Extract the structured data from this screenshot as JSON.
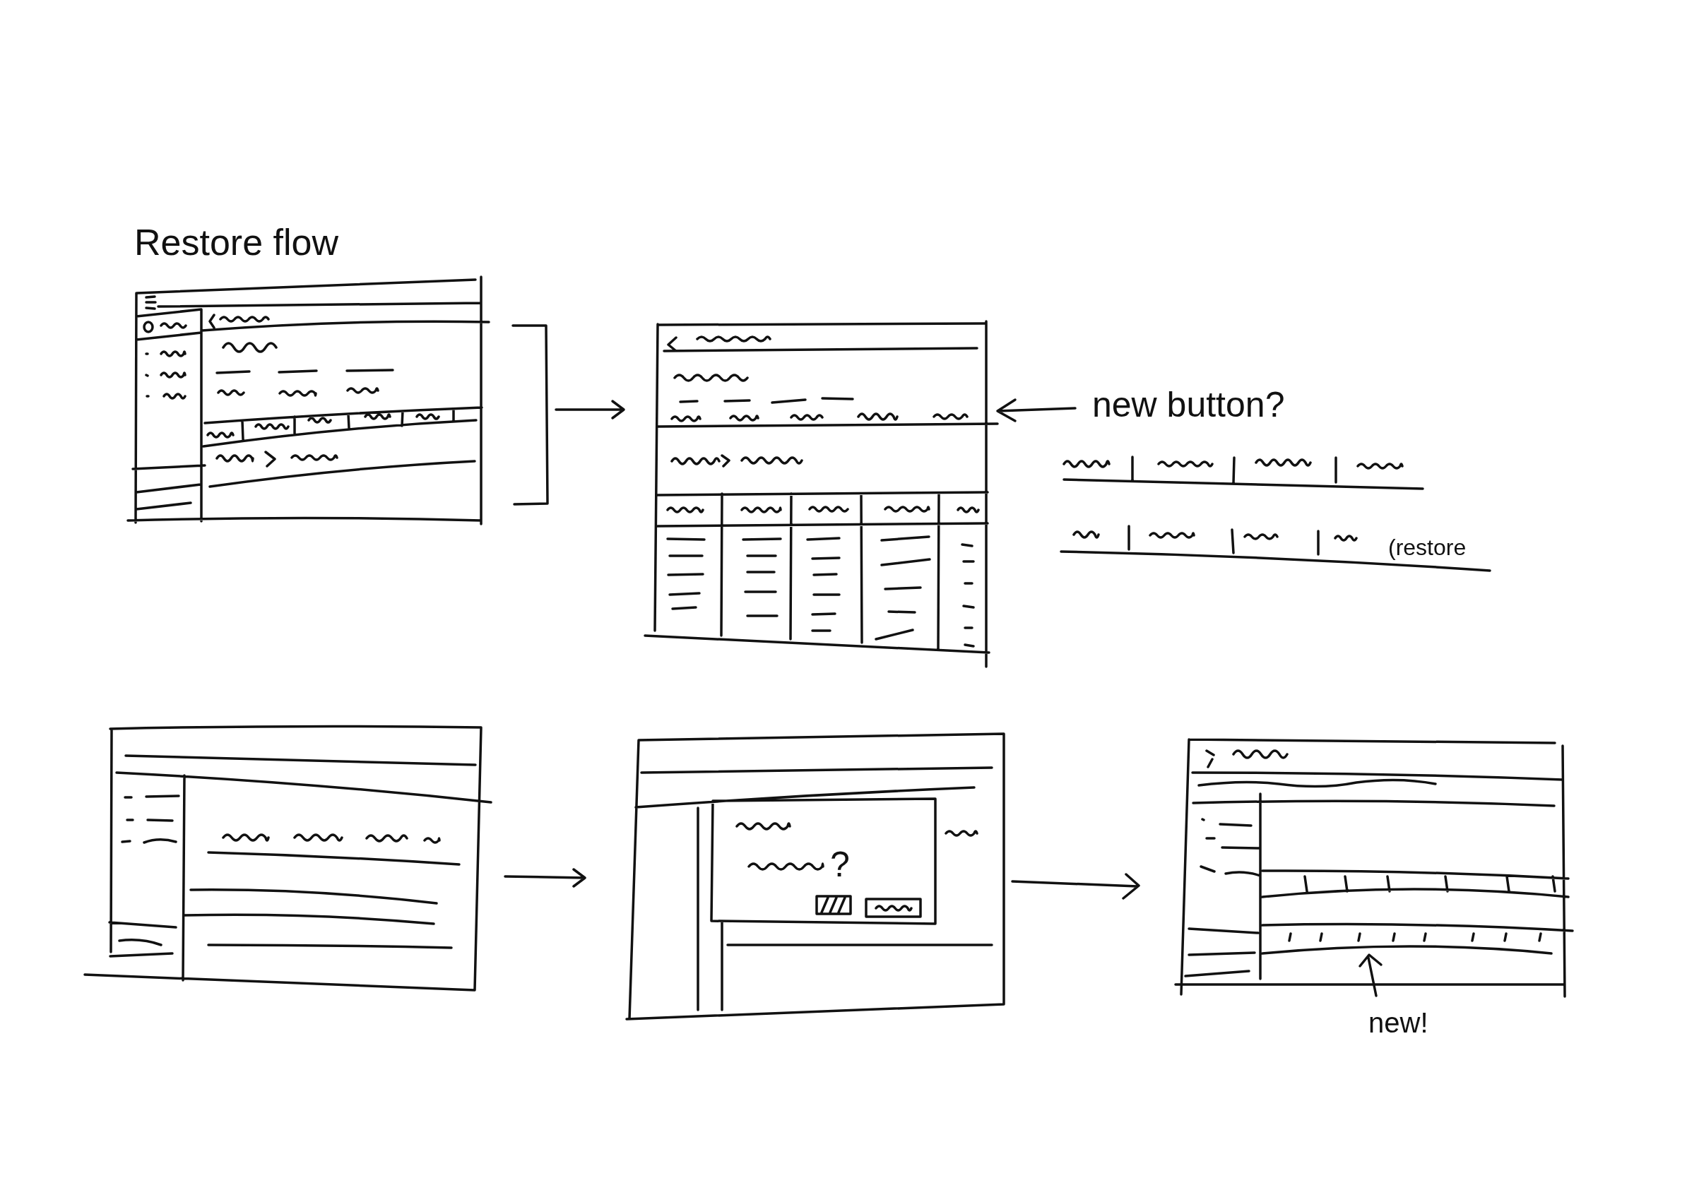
{
  "title": "Restore flow",
  "sketches": [
    {
      "kind": "app-screen"
    },
    {
      "kind": "detail-screen",
      "callout": "new button?"
    },
    {
      "kind": "tab-bar"
    },
    {
      "kind": "tab-bar-restore",
      "label": "(restore"
    },
    {
      "kind": "list-screen"
    },
    {
      "kind": "dialog-screen",
      "prompt_mark": "?"
    },
    {
      "kind": "timeline-screen",
      "callout": "new!"
    }
  ]
}
